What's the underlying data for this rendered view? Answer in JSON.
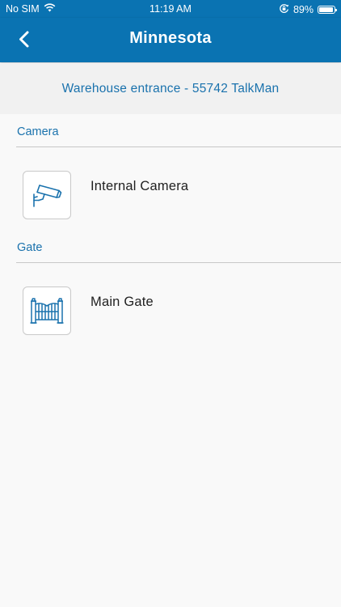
{
  "status_bar": {
    "carrier": "No SIM",
    "time": "11:19 AM",
    "battery": "89%",
    "wifi_icon": "wifi-icon",
    "lock_icon": "orientation-lock-icon",
    "battery_icon": "battery-icon"
  },
  "header": {
    "title": "Minnesota",
    "back_icon": "chevron-left-icon"
  },
  "location": {
    "subtitle": "Warehouse entrance - 55742 TalkMan"
  },
  "sections": [
    {
      "title": "Camera",
      "devices": [
        {
          "label": "Internal Camera",
          "icon": "security-camera-icon"
        }
      ]
    },
    {
      "title": "Gate",
      "devices": [
        {
          "label": "Main Gate",
          "icon": "gate-icon"
        }
      ]
    }
  ],
  "colors": {
    "brand_blue": "#0a73b2",
    "accent_text": "#1a72ad",
    "background": "#f9f9f9"
  }
}
